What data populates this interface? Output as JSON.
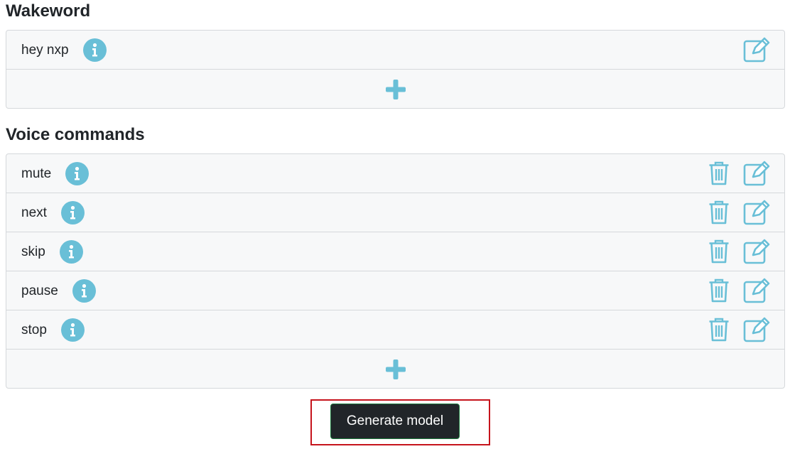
{
  "wakeword": {
    "title": "Wakeword",
    "items": [
      {
        "label": "hey nxp"
      }
    ]
  },
  "voice_commands": {
    "title": "Voice commands",
    "items": [
      {
        "label": "mute"
      },
      {
        "label": "next"
      },
      {
        "label": "skip"
      },
      {
        "label": "pause"
      },
      {
        "label": "stop"
      }
    ]
  },
  "generate": {
    "label": "Generate model"
  },
  "colors": {
    "icon_accent": "#69bfd7",
    "button_bg": "#212529",
    "highlight_frame": "#c6141c"
  },
  "icons": {
    "info": "info-icon",
    "edit": "edit-icon",
    "delete": "trash-icon",
    "add": "plus-icon"
  }
}
